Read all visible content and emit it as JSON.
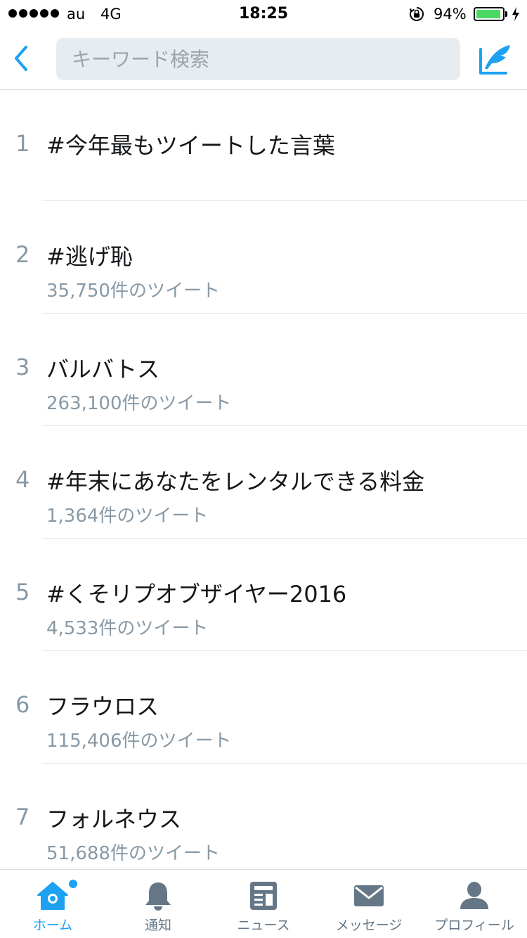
{
  "status_bar": {
    "carrier": "au",
    "network": "4G",
    "time": "18:25",
    "battery_percent": "94%",
    "battery_level": 0.94,
    "battery_color": "#4cd964"
  },
  "nav": {
    "back_icon": "chevron-left-icon",
    "search_placeholder": "キーワード検索",
    "compose_icon": "compose-tweet-icon",
    "accent_color": "#1da1f2"
  },
  "trends": [
    {
      "rank": "1",
      "name": "#今年最もツイートした言葉",
      "count": ""
    },
    {
      "rank": "2",
      "name": "#逃げ恥",
      "count": "35,750件のツイート"
    },
    {
      "rank": "3",
      "name": "バルバトス",
      "count": "263,100件のツイート"
    },
    {
      "rank": "4",
      "name": "#年末にあなたをレンタルできる料金",
      "count": "1,364件のツイート"
    },
    {
      "rank": "5",
      "name": "#くそリプオブザイヤー2016",
      "count": "4,533件のツイート"
    },
    {
      "rank": "6",
      "name": "フラウロス",
      "count": "115,406件のツイート"
    },
    {
      "rank": "7",
      "name": "フォルネウス",
      "count": "51,688件のツイート"
    }
  ],
  "tabs": [
    {
      "label": "ホーム",
      "icon": "home-icon",
      "active": true
    },
    {
      "label": "通知",
      "icon": "bell-icon",
      "active": false
    },
    {
      "label": "ニュース",
      "icon": "news-icon",
      "active": false
    },
    {
      "label": "メッセージ",
      "icon": "envelope-icon",
      "active": false
    },
    {
      "label": "プロフィール",
      "icon": "person-icon",
      "active": false
    }
  ]
}
